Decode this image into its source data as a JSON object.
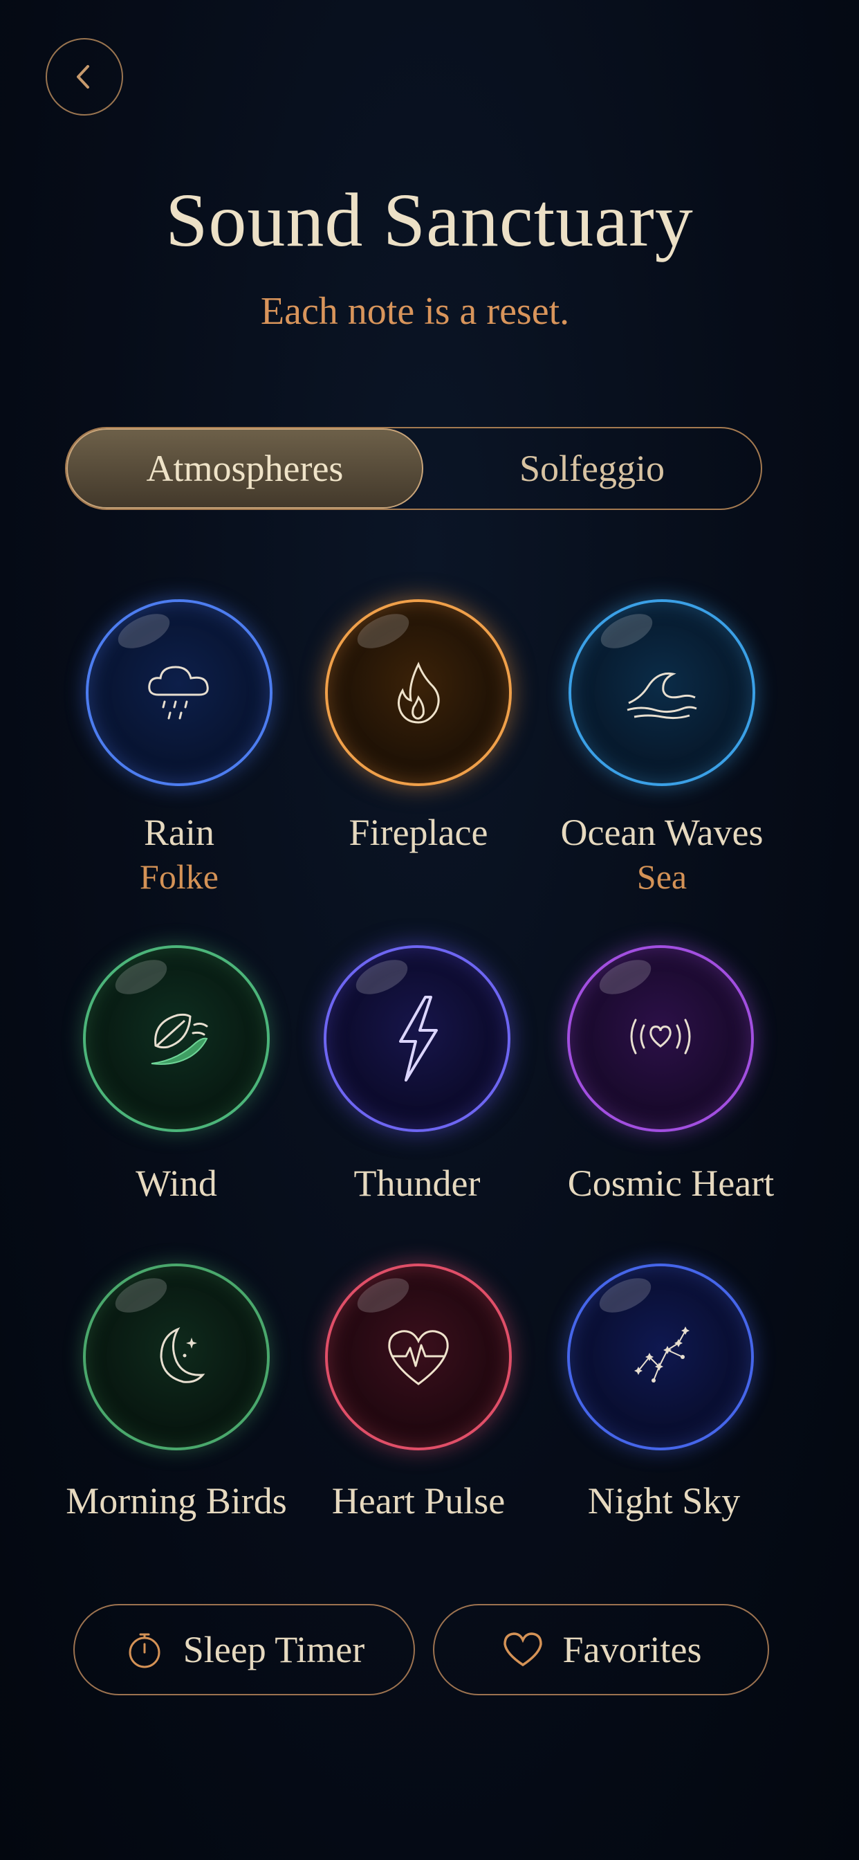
{
  "header": {
    "title": "Sound Sanctuary",
    "subtitle": "Each note is a reset."
  },
  "tabs": [
    {
      "label": "Atmospheres",
      "active": true
    },
    {
      "label": "Solfeggio",
      "active": false
    }
  ],
  "sounds": [
    {
      "name": "Rain",
      "sub": "Folke",
      "icon": "rain-cloud-icon",
      "color": "#2d5fd6"
    },
    {
      "name": "Fireplace",
      "sub": "",
      "icon": "flame-icon",
      "color": "#e38a2c"
    },
    {
      "name": "Ocean Waves",
      "sub": "Sea",
      "icon": "wave-icon",
      "color": "#2b8fd3"
    },
    {
      "name": "Wind",
      "sub": "",
      "icon": "leaf-wind-icon",
      "color": "#3b9a63"
    },
    {
      "name": "Thunder",
      "sub": "",
      "icon": "lightning-icon",
      "color": "#5a4fe6"
    },
    {
      "name": "Cosmic Heart",
      "sub": "",
      "icon": "heart-signal-icon",
      "color": "#9a3fd4"
    },
    {
      "name": "Morning Birds",
      "sub": "",
      "icon": "moon-stars-icon",
      "color": "#3a8a55"
    },
    {
      "name": "Heart Pulse",
      "sub": "",
      "icon": "heartbeat-icon",
      "color": "#d0425a"
    },
    {
      "name": "Night Sky",
      "sub": "",
      "icon": "constellation-icon",
      "color": "#3047d8"
    }
  ],
  "footer": {
    "sleep_timer": "Sleep Timer",
    "favorites": "Favorites"
  },
  "colors": {
    "accent": "#d9955b",
    "border": "#9d7350",
    "background": "#060c18"
  }
}
